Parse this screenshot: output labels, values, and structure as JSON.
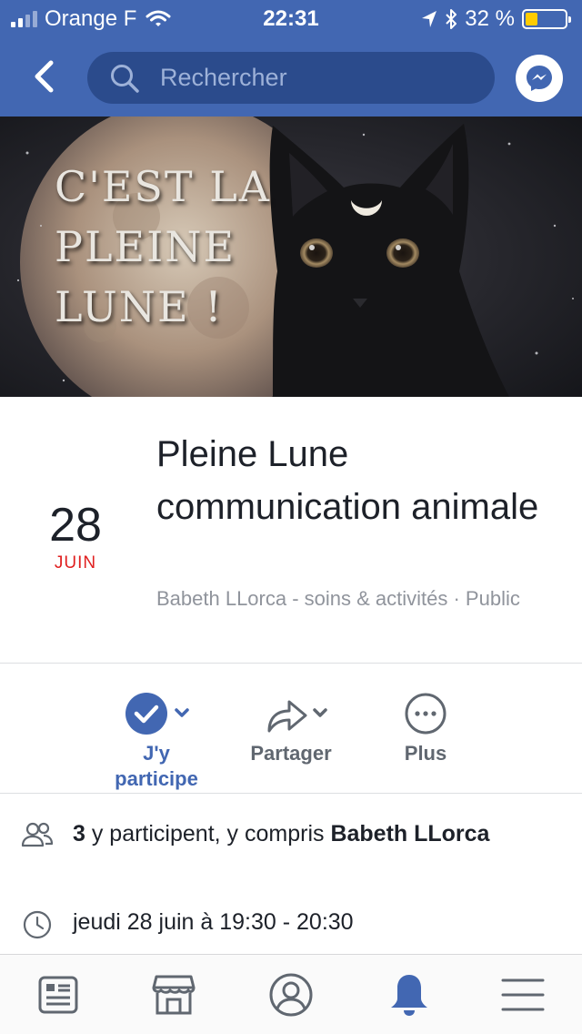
{
  "status_bar": {
    "carrier": "Orange F",
    "time": "22:31",
    "battery_percent": "32 %",
    "battery_level": 0.32,
    "battery_color": "#ffcc00",
    "signal_bars_filled": 2,
    "signal_bars_total": 4
  },
  "nav": {
    "search_placeholder": "Rechercher",
    "back_icon": "chevron-left-icon",
    "messenger_icon": "messenger-icon",
    "bar_color": "#4267b2"
  },
  "cover": {
    "title": "C'EST LA\nPLEINE\nLUNE !"
  },
  "event": {
    "day": "28",
    "month": "JUIN",
    "title": "Pleine Lune communication animale",
    "subtitle": "Babeth LLorca - soins & activités · Public"
  },
  "actions": {
    "going_label": "J'y participe",
    "share_label": "Partager",
    "more_label": "Plus",
    "accent_color": "#4267b2"
  },
  "details": {
    "participants_count": "3",
    "participants_text": " y participent, y compris ",
    "participants_name": "Babeth LLorca",
    "datetime": "jeudi 28 juin à 19:30 - 20:30"
  },
  "tabbar": {
    "tabs": [
      {
        "icon": "news-feed-icon",
        "active": false
      },
      {
        "icon": "marketplace-icon",
        "active": false
      },
      {
        "icon": "profile-icon",
        "active": false
      },
      {
        "icon": "notifications-bell-icon",
        "active": true
      },
      {
        "icon": "menu-icon",
        "active": false
      }
    ]
  }
}
